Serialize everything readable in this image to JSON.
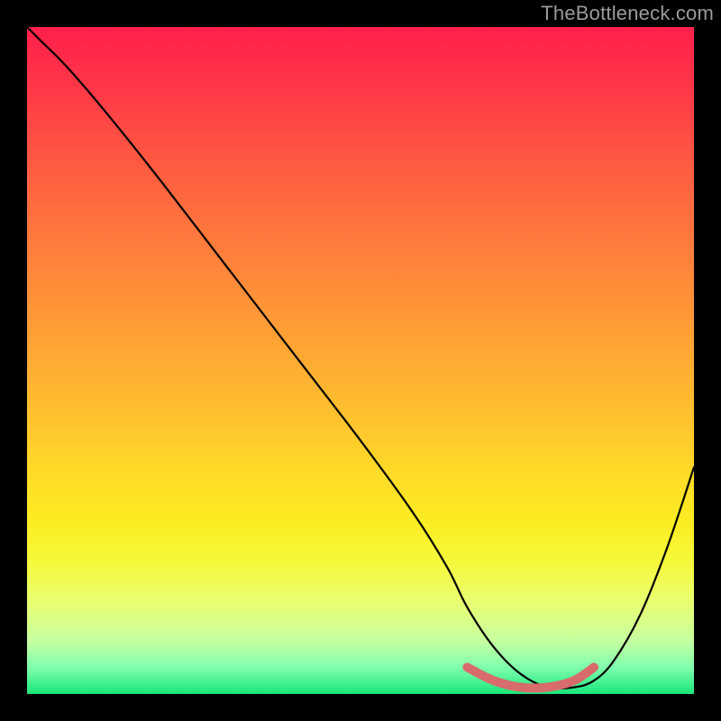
{
  "watermark": "TheBottleneck.com",
  "chart_data": {
    "type": "line",
    "title": "",
    "xlabel": "",
    "ylabel": "",
    "xlim": [
      0,
      100
    ],
    "ylim": [
      0,
      100
    ],
    "series": [
      {
        "name": "bottleneck-curve",
        "x": [
          0,
          2,
          6,
          12,
          20,
          30,
          40,
          50,
          58,
          63,
          66,
          70,
          74,
          78,
          82,
          85,
          88,
          92,
          96,
          100
        ],
        "values": [
          100,
          98,
          94,
          87,
          77,
          64,
          51,
          38,
          27,
          19,
          13,
          7,
          3,
          1,
          1,
          2,
          5,
          12,
          22,
          34
        ]
      },
      {
        "name": "optimal-range-marker",
        "x": [
          66,
          70,
          74,
          78,
          82,
          85
        ],
        "values": [
          4,
          2,
          1,
          1,
          2,
          4
        ]
      }
    ],
    "gradient": {
      "top": "#ff1f4b",
      "mid": "#ffd828",
      "bottom": "#19e67a"
    }
  }
}
